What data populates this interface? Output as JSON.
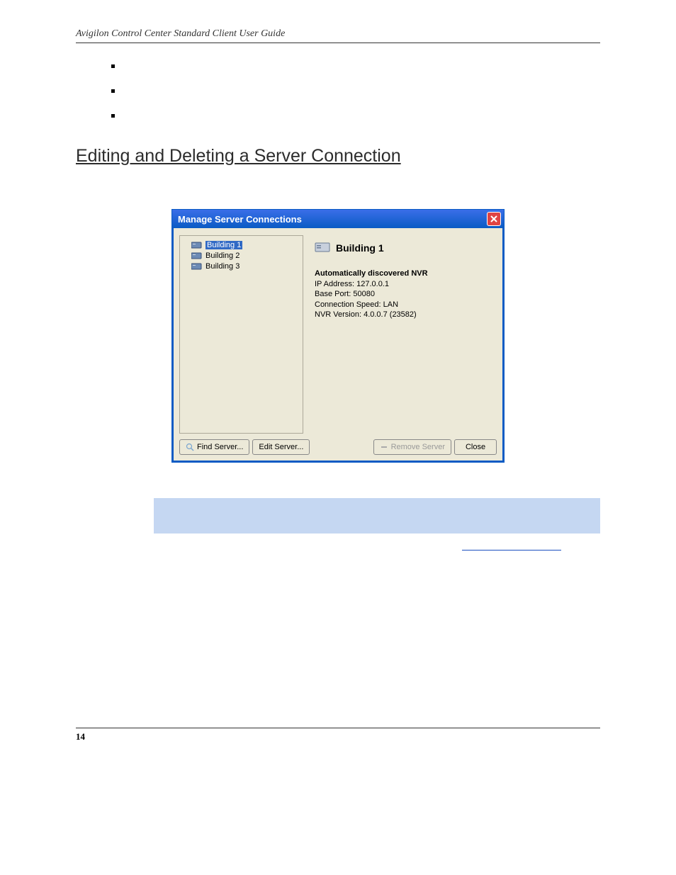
{
  "page_header": "Avigilon Control Center Standard Client User Guide",
  "section_title": "Editing and Deleting a Server Connection",
  "window": {
    "title": "Manage Server Connections",
    "tree": [
      {
        "label": "Building 1",
        "selected": true
      },
      {
        "label": "Building 2",
        "selected": false
      },
      {
        "label": "Building 3",
        "selected": false
      }
    ],
    "detail": {
      "title": "Building 1",
      "subtitle": "Automatically discovered NVR",
      "lines": {
        "ip": "IP Address: 127.0.0.1",
        "port": "Base Port: 50080",
        "speed": "Connection Speed: LAN",
        "version": "NVR Version: 4.0.0.7 (23582)"
      }
    },
    "buttons": {
      "find": "Find Server...",
      "edit": "Edit Server...",
      "remove": "Remove Server",
      "close": "Close"
    }
  },
  "page_number": "14"
}
